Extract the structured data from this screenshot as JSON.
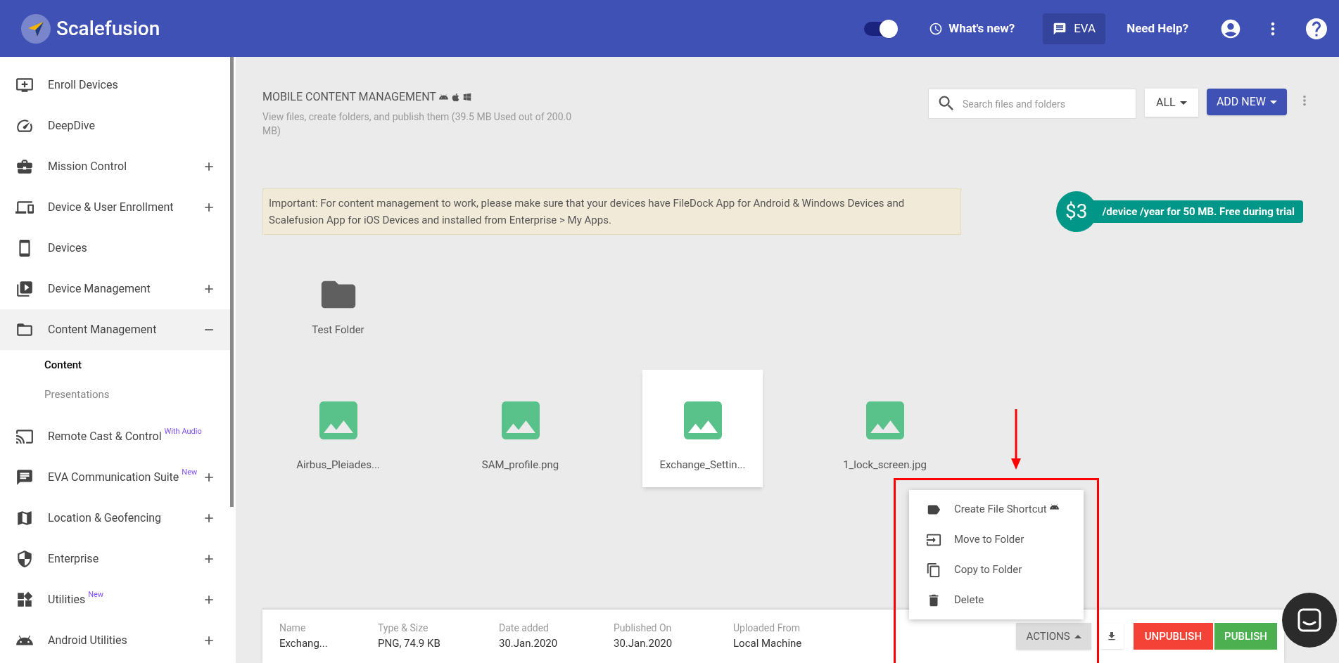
{
  "header": {
    "brand": "Scalefusion",
    "toggle_on": true,
    "whats_new": "What's new?",
    "eva": "EVA",
    "need_help": "Need Help?"
  },
  "sidebar": {
    "items": [
      {
        "label": "Enroll Devices",
        "kind": "link",
        "selected": false
      },
      {
        "label": "DeepDive",
        "kind": "link",
        "selected": false
      },
      {
        "label": "Mission Control",
        "kind": "group",
        "selected": false,
        "expanded": false
      },
      {
        "label": "Device & User Enrollment",
        "kind": "group",
        "selected": false,
        "expanded": false
      },
      {
        "label": "Devices",
        "kind": "link",
        "selected": false
      },
      {
        "label": "Device Management",
        "kind": "group",
        "selected": false,
        "expanded": false
      },
      {
        "label": "Content Management",
        "kind": "group",
        "selected": true,
        "expanded": true,
        "children": [
          {
            "label": "Content",
            "selected": true
          },
          {
            "label": "Presentations",
            "selected": false
          }
        ]
      },
      {
        "label": "Remote Cast & Control",
        "kind": "link",
        "selected": false,
        "badge": "With Audio"
      },
      {
        "label": "EVA Communication Suite",
        "kind": "group",
        "selected": false,
        "expanded": false,
        "badge": "New"
      },
      {
        "label": "Location & Geofencing",
        "kind": "group",
        "selected": false,
        "expanded": false
      },
      {
        "label": "Enterprise",
        "kind": "group",
        "selected": false,
        "expanded": false
      },
      {
        "label": "Utilities",
        "kind": "group",
        "selected": false,
        "expanded": false,
        "badge": "New"
      },
      {
        "label": "Android Utilities",
        "kind": "group",
        "selected": false,
        "expanded": false
      }
    ]
  },
  "page": {
    "title": "MOBILE CONTENT MANAGEMENT",
    "subtitle": "View files, create folders, and publish them (39.5 MB Used out of 200.0 MB)",
    "search": {
      "placeholder": "Search files and folders"
    },
    "filter": "ALL",
    "add_new": "ADD NEW",
    "notice": "Important: For content management to work, please make sure that your devices have FileDock App for Android & Windows Devices and Scalefusion App for iOS Devices and installed from Enterprise > My Apps.",
    "price": {
      "amount": "$3",
      "text": "/device /year for 50 MB. Free during trial"
    }
  },
  "folders": [
    {
      "name": "Test Folder",
      "selected": false
    }
  ],
  "files": [
    {
      "name": "Airbus_Pleiades...",
      "selected": false
    },
    {
      "name": "SAM_profile.png",
      "selected": false
    },
    {
      "name": "Exchange_Settin...",
      "selected": true
    },
    {
      "name": "1_lock_screen.jpg",
      "selected": false
    }
  ],
  "actions_menu": [
    {
      "label": "Create File Shortcut",
      "android_only": true
    },
    {
      "label": "Move to Folder",
      "android_only": false
    },
    {
      "label": "Copy to Folder",
      "android_only": false
    },
    {
      "label": "Delete",
      "android_only": false
    }
  ],
  "details": {
    "fields": [
      {
        "label": "Name",
        "value": "Exchang..."
      },
      {
        "label": "Type & Size",
        "value": "PNG, 74.9 KB"
      },
      {
        "label": "Date added",
        "value": "30.Jan.2020"
      },
      {
        "label": "Published On",
        "value": "30.Jan.2020"
      },
      {
        "label": "Uploaded From",
        "value": "Local Machine"
      }
    ],
    "actions": "ACTIONS",
    "actions_open": true,
    "unpublish": "UNPUBLISH",
    "publish": "PUBLISH"
  }
}
